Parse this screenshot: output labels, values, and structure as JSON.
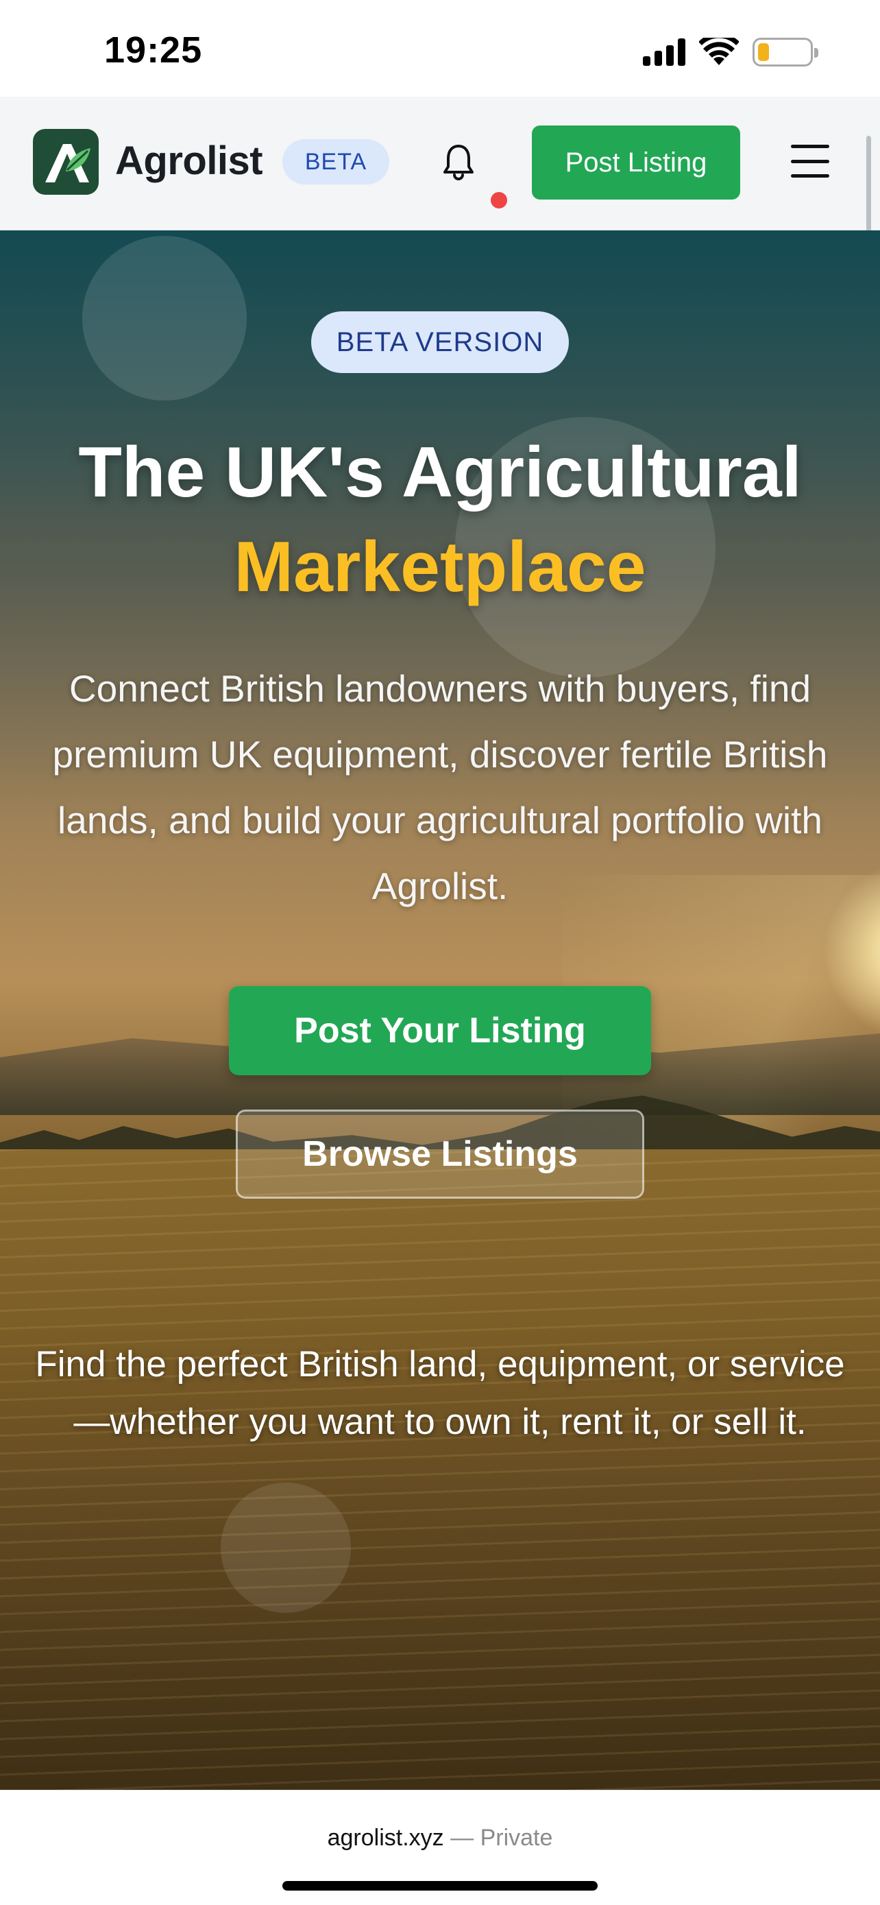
{
  "status_bar": {
    "time": "19:25"
  },
  "header": {
    "brand": "Agrolist",
    "beta_badge": "BETA",
    "post_button": "Post Listing",
    "icons": {
      "logo": "agrolist-logo-icon",
      "notifications": "bell-icon",
      "menu": "hamburger-menu-icon"
    },
    "colors": {
      "brand_green": "#22a755",
      "logo_bg": "#1f4d36",
      "notification_dot": "#ef4444"
    }
  },
  "hero": {
    "badge": "BETA VERSION",
    "title_line1": "The UK's Agricultural",
    "title_highlight": "Marketplace",
    "description": "Connect British landowners with buyers, find premium UK equipment, discover fertile British lands, and build your agricultural portfolio with Agrolist.",
    "primary_cta": "Post Your Listing",
    "secondary_cta": "Browse Listings",
    "tagline": "Find the perfect British land, equipment, or service—whether you want to own it, rent it, or sell it.",
    "colors": {
      "highlight": "#fbbf24",
      "badge_bg": "#dbe7fb",
      "badge_text": "#1e3a8a"
    }
  },
  "browser": {
    "domain": "agrolist.xyz",
    "separator": "—",
    "mode": "Private"
  }
}
